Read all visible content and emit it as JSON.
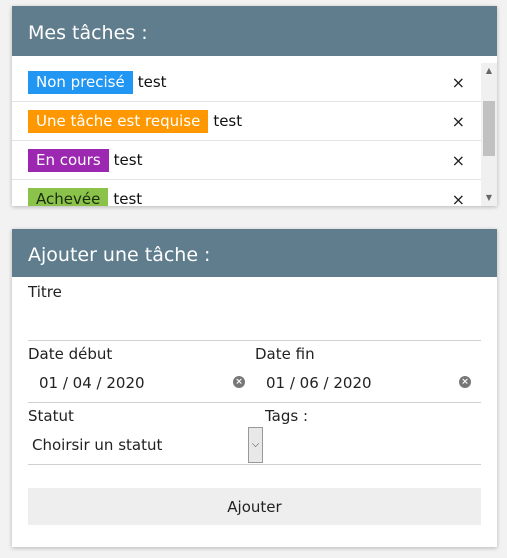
{
  "tasks_panel": {
    "title": "Mes tâches :",
    "delete_glyph": "×",
    "tasks": [
      {
        "status_label": "Non precisé",
        "status_color": "#2196f3",
        "name": "test"
      },
      {
        "status_label": "Une tâche est requise",
        "status_color": "#ff9800",
        "name": "test"
      },
      {
        "status_label": "En cours",
        "status_color": "#9c27b0",
        "name": "test"
      },
      {
        "status_label": "Achevée",
        "status_color": "#8bc34a",
        "name": "test"
      }
    ]
  },
  "add_panel": {
    "title": "Ajouter une tâche :",
    "title_field_label": "Titre",
    "title_field_value": "",
    "start_date_label": "Date début",
    "start_date_value": "01 / 04 / 2020",
    "end_date_label": "Date fin",
    "end_date_value": "01 / 06 / 2020",
    "status_label": "Statut",
    "status_value": "Choirsir un statut",
    "tags_label": "Tags :",
    "submit_label": "Ajouter"
  },
  "colors": {
    "header": "#5f7d8c"
  }
}
